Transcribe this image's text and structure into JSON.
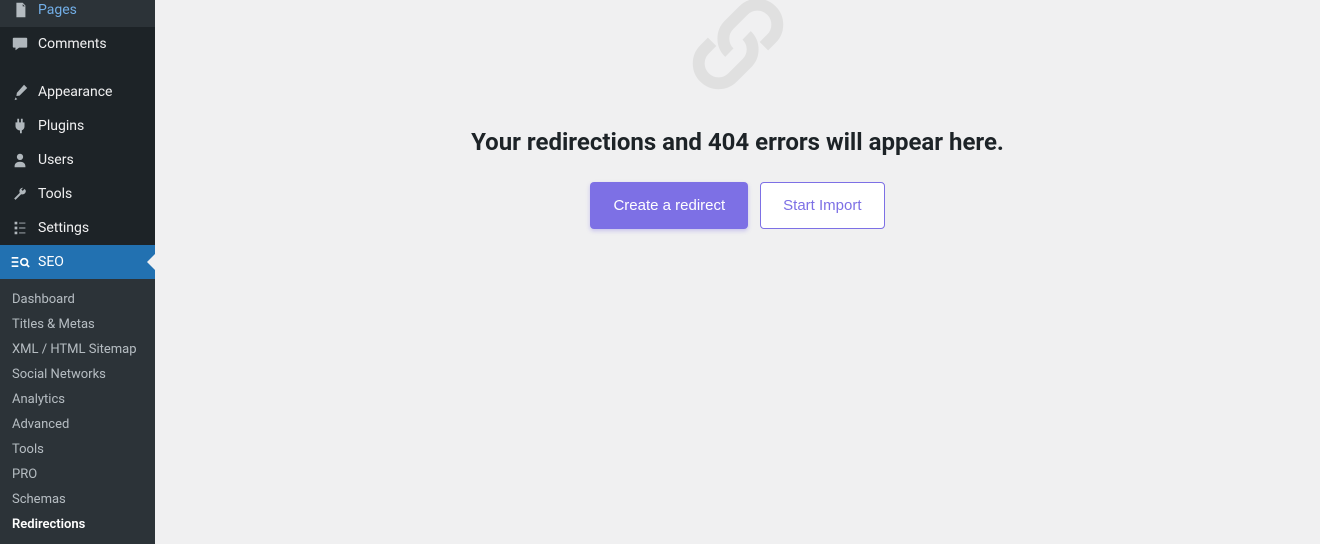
{
  "sidebar": {
    "items": [
      {
        "label": "Pages",
        "icon": "pages"
      },
      {
        "label": "Comments",
        "icon": "comments"
      },
      {
        "label": "",
        "separator": true
      },
      {
        "label": "Appearance",
        "icon": "appearance"
      },
      {
        "label": "Plugins",
        "icon": "plugins"
      },
      {
        "label": "Users",
        "icon": "users"
      },
      {
        "label": "Tools",
        "icon": "tools"
      },
      {
        "label": "Settings",
        "icon": "settings"
      },
      {
        "label": "SEO",
        "icon": "seo",
        "active": true
      }
    ],
    "submenu": [
      "Dashboard",
      "Titles & Metas",
      "XML / HTML Sitemap",
      "Social Networks",
      "Analytics",
      "Advanced",
      "Tools",
      "PRO",
      "Schemas",
      "Redirections"
    ],
    "submenu_current": "Redirections"
  },
  "content": {
    "empty_title": "Your redirections and 404 errors will appear here.",
    "create_button": "Create a redirect",
    "import_button": "Start Import"
  },
  "colors": {
    "accent": "#7D70E5",
    "sidebar_bg": "#1d2327",
    "body_bg": "#f0f0f1"
  }
}
